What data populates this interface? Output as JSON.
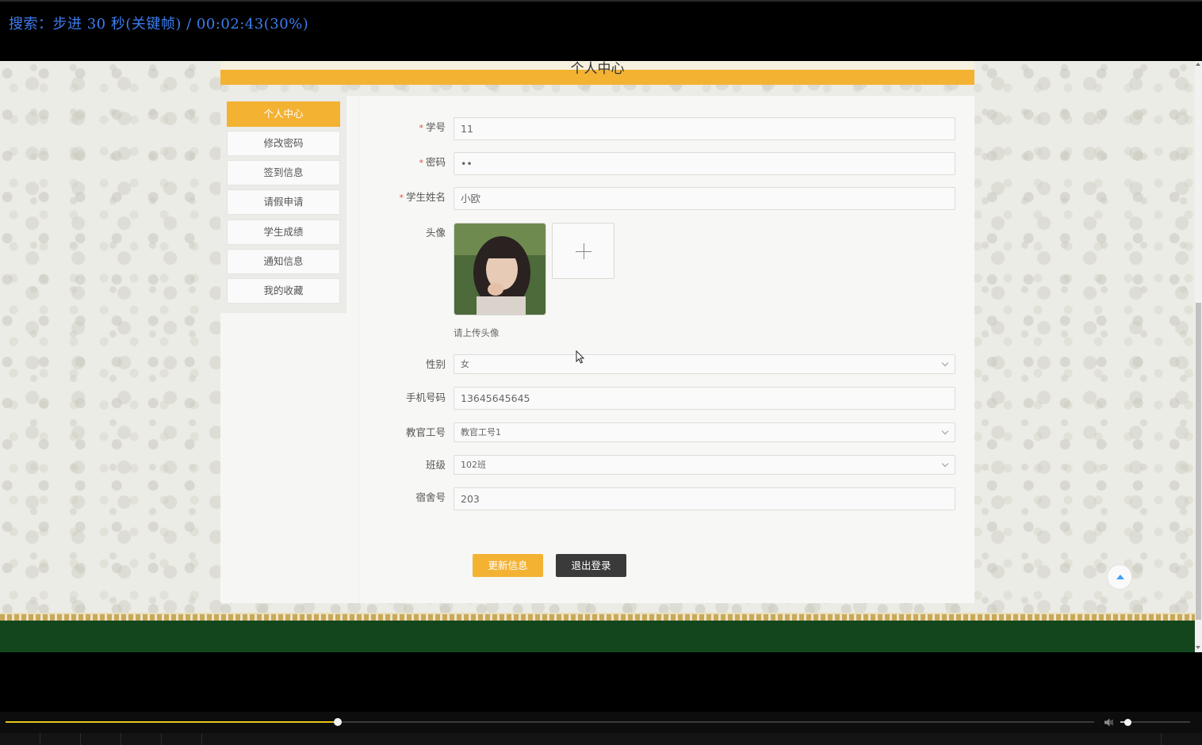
{
  "osd": {
    "text": "搜索：步进 30 秒(关键帧) / 00:02:43(30%)"
  },
  "page": {
    "title": "个人中心"
  },
  "sidebar": {
    "items": [
      {
        "label": "个人中心",
        "active": true
      },
      {
        "label": "修改密码",
        "active": false
      },
      {
        "label": "签到信息",
        "active": false
      },
      {
        "label": "请假申请",
        "active": false
      },
      {
        "label": "学生成绩",
        "active": false
      },
      {
        "label": "通知信息",
        "active": false
      },
      {
        "label": "我的收藏",
        "active": false
      }
    ]
  },
  "form": {
    "student_id": {
      "label": "学号",
      "value": "11",
      "required": true
    },
    "password": {
      "label": "密码",
      "value": "••",
      "required": true
    },
    "student_name": {
      "label": "学生姓名",
      "value": "小欧",
      "required": true
    },
    "avatar": {
      "label": "头像",
      "hint": "请上传头像"
    },
    "gender": {
      "label": "性别",
      "value": "女"
    },
    "phone": {
      "label": "手机号码",
      "value": "13645645645"
    },
    "teacher_id": {
      "label": "教官工号",
      "value": "教官工号1"
    },
    "class": {
      "label": "班级",
      "value": "102班"
    },
    "dorm": {
      "label": "宿舍号",
      "value": "203"
    },
    "required_mark": "*"
  },
  "actions": {
    "update_label": "更新信息",
    "logout_label": "退出登录"
  },
  "player": {
    "progress": 0.305,
    "volume": 0.1
  },
  "colors": {
    "accent": "#f4b233",
    "footer": "#14461e",
    "osd_text": "#3d7df0",
    "progress": "#e8c81a"
  }
}
